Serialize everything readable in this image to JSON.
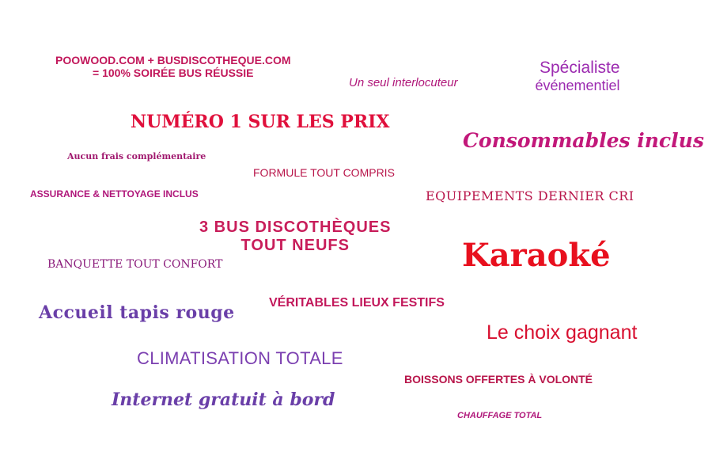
{
  "words": {
    "poowood_line1": "POOWOOD.COM + BUSDISCOTHEQUE.COM",
    "poowood_line2": "= 100% SOIRÉE BUS RÉUSSIE",
    "seul": "Un seul interlocuteur",
    "specialiste_line1": "Spécialiste",
    "specialiste_line2": "événementiel",
    "numero1": "NUMÉRO 1 SUR LES PRIX",
    "consommables": "Consommables inclus",
    "aucun": "Aucun frais complémentaire",
    "formule": "FORMULE TOUT COMPRIS",
    "assurance": "ASSURANCE & NETTOYAGE INCLUS",
    "equipements": "EQUIPEMENTS DERNIER CRI",
    "bus_line1": "3 BUS DISCOTHÈQUES",
    "bus_line2": "TOUT NEUFS",
    "karaoke": "Karaoké",
    "banquette": "BANQUETTE TOUT CONFORT",
    "veritables": "VÉRITABLES LIEUX FESTIFS",
    "accueil": "Accueil tapis rouge",
    "choix": "Le choix gagnant",
    "climatisation": "CLIMATISATION TOTALE",
    "boissons": "BOISSONS OFFERTES À VOLONTÉ",
    "internet": "Internet gratuit à bord",
    "chauffage": "CHAUFFAGE TOTAL"
  },
  "colors": {
    "poowood": "#c2185b",
    "seul": "#b0177a",
    "specialiste": "#9c2bb0",
    "numero1": "#e0103c",
    "consommables": "#c2187a",
    "aucun": "#a0186e",
    "formule": "#b8154a",
    "assurance": "#b0177a",
    "equipements": "#b8154a",
    "bus": "#c81d5a",
    "karaoke": "#e8101e",
    "banquette": "#8a1a7a",
    "veritables": "#c2185b",
    "accueil": "#6a3fa8",
    "choix": "#d81030",
    "climatisation": "#7b3fb0",
    "boissons": "#b8154a",
    "internet": "#6a3fa8",
    "chauffage": "#b0177a"
  }
}
